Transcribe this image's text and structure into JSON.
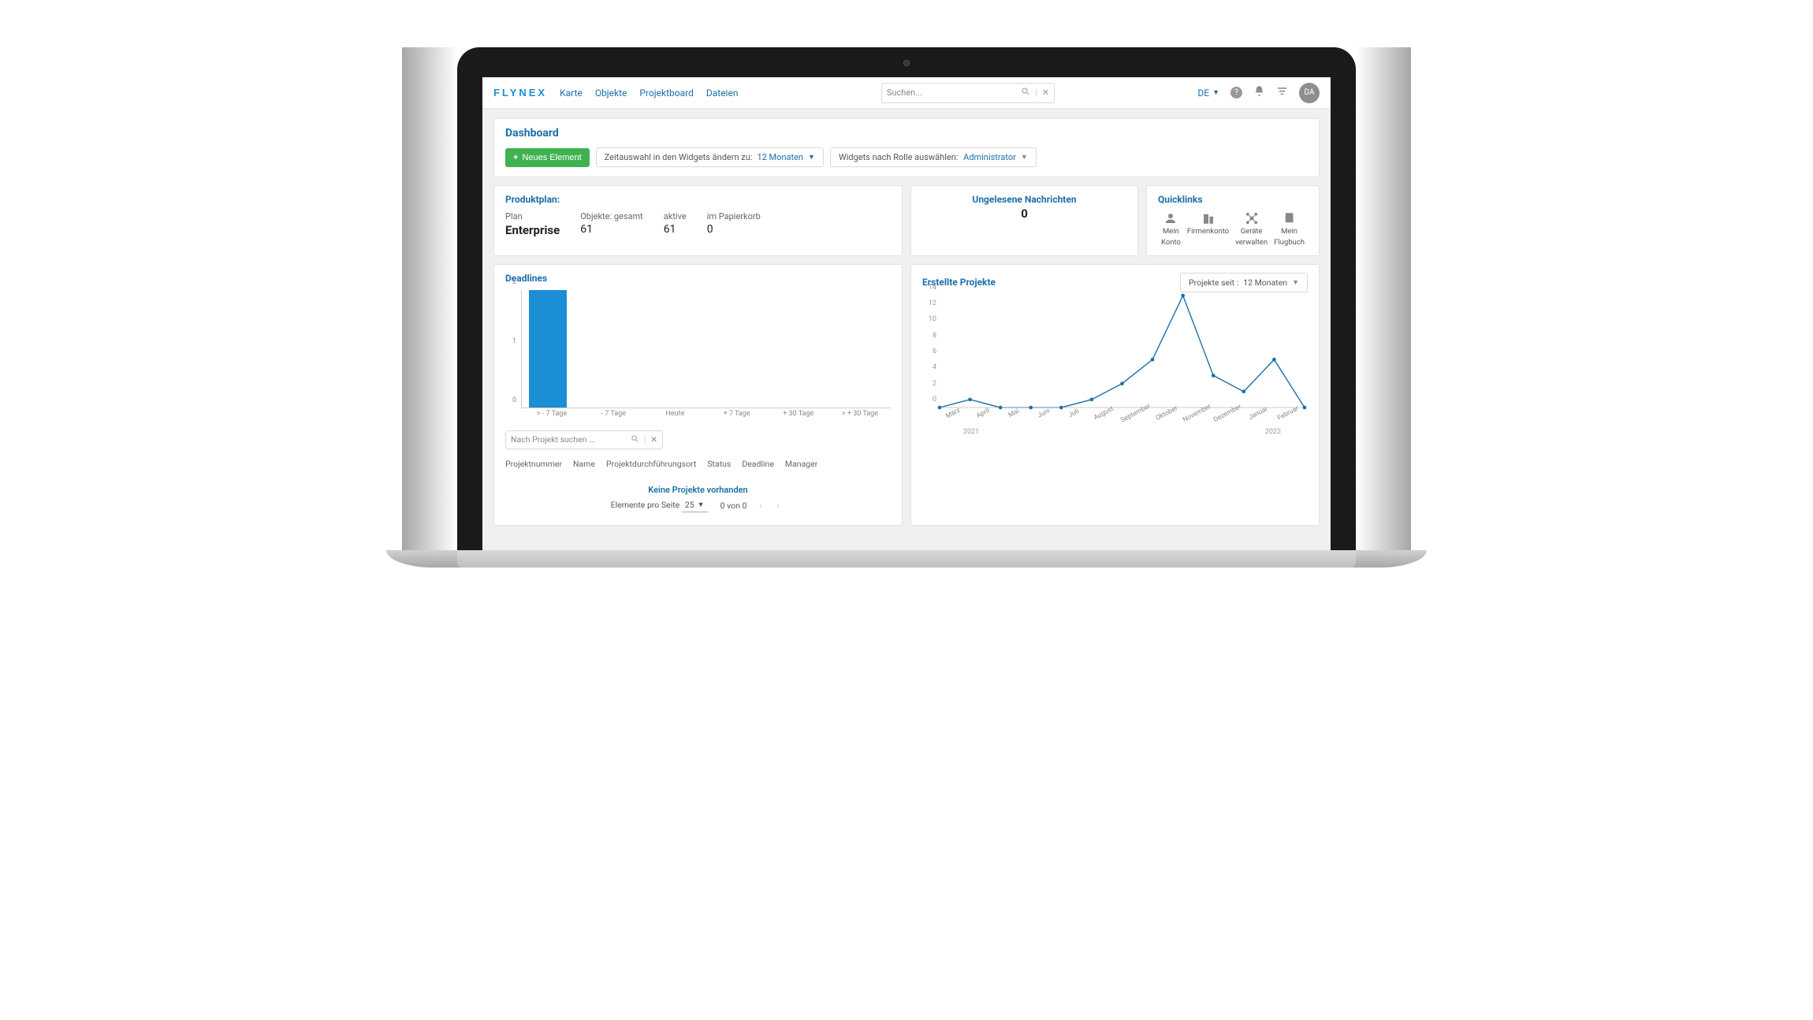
{
  "brand": "FLYNEX",
  "nav": [
    "Karte",
    "Objekte",
    "Projektboard",
    "Dateien"
  ],
  "search": {
    "placeholder": "Suchen..."
  },
  "lang": "DE",
  "avatar": "DA",
  "dashboard": {
    "title": "Dashboard",
    "new_btn": "Neues Element",
    "time_label": "Zeitauswahl in den Widgets ändern zu:",
    "time_value": "12 Monaten",
    "role_label": "Widgets nach Rolle auswählen:",
    "role_value": "Administrator"
  },
  "productplan": {
    "title": "Produktplan:",
    "plan_lbl": "Plan",
    "plan_val": "Enterprise",
    "obj_lbl": "Objekte: gesamt",
    "obj_val": "61",
    "active_lbl": "aktive",
    "active_val": "61",
    "trash_lbl": "im Papierkorb",
    "trash_val": "0"
  },
  "messages": {
    "title": "Ungelesene Nachrichten",
    "value": "0"
  },
  "quicklinks": {
    "title": "Quicklinks",
    "items": [
      {
        "l1": "Mein",
        "l2": "Konto"
      },
      {
        "l1": "Firmenkonto",
        "l2": ""
      },
      {
        "l1": "Geräte",
        "l2": "verwalten"
      },
      {
        "l1": "Mein",
        "l2": "Flugbuch"
      }
    ]
  },
  "deadlines": {
    "title": "Deadlines",
    "search_placeholder": "Nach Projekt suchen ...",
    "columns": [
      "Projektnummer",
      "Name",
      "Projektdurchführungsort",
      "Status",
      "Deadline",
      "Manager"
    ],
    "empty": "Keine Projekte vorhanden",
    "per_page_lbl": "Elemente pro Seite",
    "per_page_val": "25",
    "range": "0 von 0"
  },
  "projects": {
    "title": "Erstellte Projekte",
    "filter_lbl": "Projekte seit :",
    "filter_val": "12 Monaten",
    "year_left": "2021",
    "year_right": "2022"
  },
  "chart_data": [
    {
      "type": "bar",
      "title": "Deadlines",
      "categories": [
        "> - 7 Tage",
        "- 7 Tage",
        "Heute",
        "+ 7 Tage",
        "+ 30 Tage",
        "> + 30 Tage"
      ],
      "values": [
        2,
        0,
        0,
        0,
        0,
        0
      ],
      "ylim": [
        0,
        2
      ],
      "yticks": [
        0,
        1,
        2
      ]
    },
    {
      "type": "line",
      "title": "Erstellte Projekte",
      "categories": [
        "März",
        "April",
        "Mai",
        "Juni",
        "Juli",
        "August",
        "September",
        "Oktober",
        "November",
        "Dezember",
        "Januar",
        "Februar"
      ],
      "values": [
        0,
        1,
        0,
        0,
        0,
        1,
        3,
        6,
        14,
        4,
        2,
        6,
        0
      ],
      "ylim": [
        0,
        14
      ],
      "yticks": [
        0,
        2,
        4,
        6,
        8,
        10,
        12,
        14
      ]
    }
  ]
}
